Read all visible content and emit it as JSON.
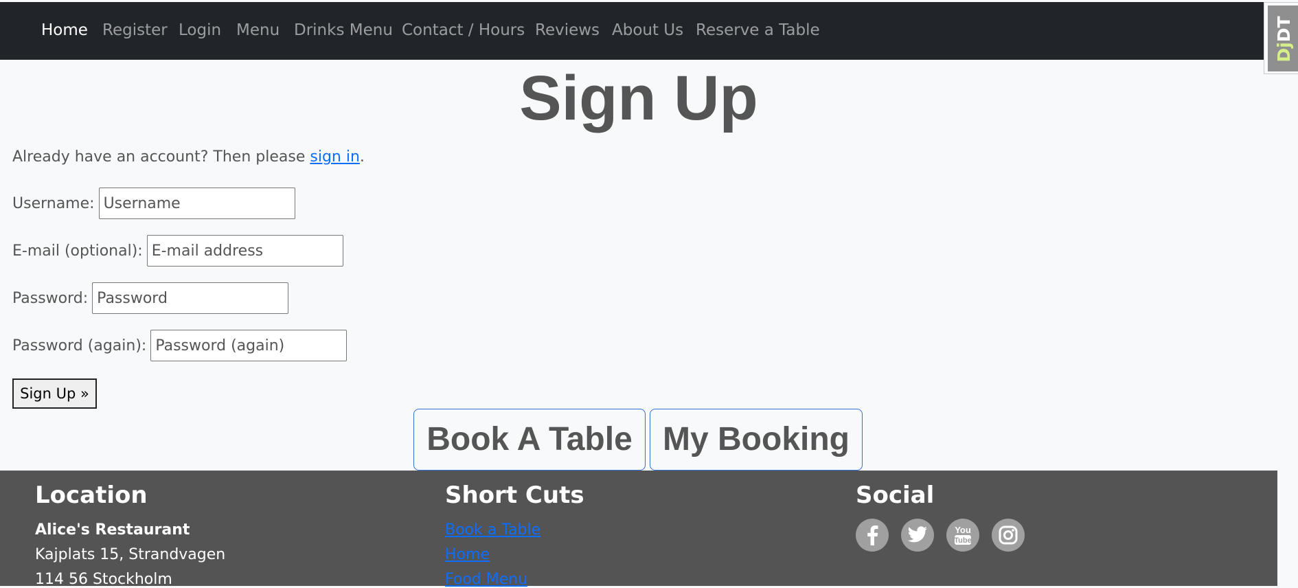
{
  "nav": {
    "items": [
      {
        "label": "Home",
        "active": true
      },
      {
        "label": "Register",
        "active": false
      },
      {
        "label": "Login",
        "active": false
      },
      {
        "label": "Menu",
        "active": false
      },
      {
        "label": "Drinks Menu",
        "active": false
      },
      {
        "label": "Contact / Hours",
        "active": false
      },
      {
        "label": "Reviews",
        "active": false
      },
      {
        "label": "About Us",
        "active": false
      },
      {
        "label": "Reserve a Table",
        "active": false
      }
    ]
  },
  "djdt": {
    "prefix": "Dj",
    "suffix": "DT"
  },
  "page": {
    "title": "Sign Up",
    "already_text": "Already have an account? Then please ",
    "signin_link": "sign in",
    "already_suffix": "."
  },
  "form": {
    "username": {
      "label": "Username:",
      "placeholder": "Username"
    },
    "email": {
      "label": "E-mail (optional):",
      "placeholder": "E-mail address"
    },
    "password": {
      "label": "Password:",
      "placeholder": "Password"
    },
    "password2": {
      "label": "Password (again):",
      "placeholder": "Password (again)"
    },
    "submit_label": "Sign Up »"
  },
  "actions": {
    "book_label": "Book A Table",
    "my_booking_label": "My Booking"
  },
  "footer": {
    "location": {
      "heading": "Location",
      "name": "Alice's Restaurant",
      "lines": [
        "Kajplats 15, Strandvagen",
        "114 56 Stockholm"
      ]
    },
    "shortcuts": {
      "heading": "Short Cuts",
      "links": [
        "Book a Table",
        "Home",
        "Food Menu"
      ]
    },
    "social": {
      "heading": "Social",
      "icons": [
        "facebook-icon",
        "twitter-icon",
        "youtube-icon",
        "instagram-icon"
      ]
    }
  },
  "colors": {
    "navbar": "#212529",
    "footer": "#545454",
    "link": "#0d6efd",
    "text": "#555555"
  }
}
